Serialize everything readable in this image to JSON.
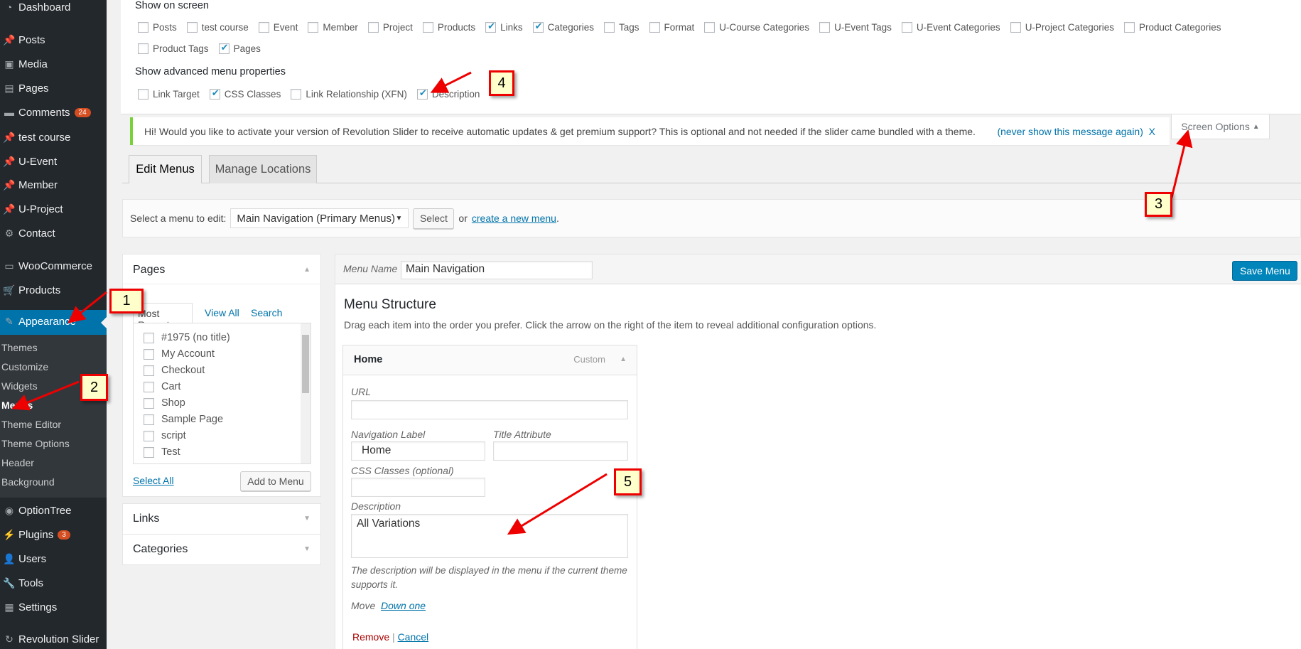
{
  "sidebar": {
    "items": [
      {
        "label": "Dashboard",
        "icon": "dashboard-icon"
      },
      {
        "label": "Posts",
        "icon": "pin-icon"
      },
      {
        "label": "Media",
        "icon": "media-icon"
      },
      {
        "label": "Pages",
        "icon": "pages-icon"
      },
      {
        "label": "Comments",
        "icon": "comment-icon",
        "badge": "24"
      },
      {
        "label": "test course",
        "icon": "pin-icon"
      },
      {
        "label": "U-Event",
        "icon": "pin-icon"
      },
      {
        "label": "Member",
        "icon": "pin-icon"
      },
      {
        "label": "U-Project",
        "icon": "pin-icon"
      },
      {
        "label": "Contact",
        "icon": "gear-icon"
      },
      {
        "label": "WooCommerce",
        "icon": "woo-icon"
      },
      {
        "label": "Products",
        "icon": "cart-icon"
      },
      {
        "label": "Appearance",
        "icon": "brush-icon"
      },
      {
        "label": "OptionTree",
        "icon": "optiontree-icon"
      },
      {
        "label": "Plugins",
        "icon": "plugin-icon",
        "badge": "3"
      },
      {
        "label": "Users",
        "icon": "user-icon"
      },
      {
        "label": "Tools",
        "icon": "wrench-icon"
      },
      {
        "label": "Settings",
        "icon": "settings-icon"
      },
      {
        "label": "Revolution Slider",
        "icon": "refresh-icon"
      }
    ],
    "submenu": [
      "Themes",
      "Customize",
      "Widgets",
      "Menus",
      "Theme Editor",
      "Theme Options",
      "Header",
      "Background"
    ],
    "active_sub": "Menus"
  },
  "screen_options": {
    "show_on_screen": "Show on screen",
    "boxes": [
      {
        "label": "Posts",
        "checked": false
      },
      {
        "label": "test course",
        "checked": false
      },
      {
        "label": "Event",
        "checked": false
      },
      {
        "label": "Member",
        "checked": false
      },
      {
        "label": "Project",
        "checked": false
      },
      {
        "label": "Products",
        "checked": false
      },
      {
        "label": "Links",
        "checked": true
      },
      {
        "label": "Categories",
        "checked": true
      },
      {
        "label": "Tags",
        "checked": false
      },
      {
        "label": "Format",
        "checked": false
      },
      {
        "label": "U-Course Categories",
        "checked": false
      },
      {
        "label": "U-Event Tags",
        "checked": false
      },
      {
        "label": "U-Event Categories",
        "checked": false
      },
      {
        "label": "U-Project Categories",
        "checked": false
      },
      {
        "label": "Product Categories",
        "checked": false
      },
      {
        "label": "Product Tags",
        "checked": false
      },
      {
        "label": "Pages",
        "checked": true
      }
    ],
    "advanced_title": "Show advanced menu properties",
    "advanced": [
      {
        "label": "Link Target",
        "checked": false
      },
      {
        "label": "CSS Classes",
        "checked": true
      },
      {
        "label": "Link Relationship (XFN)",
        "checked": false
      },
      {
        "label": "Description",
        "checked": true
      }
    ],
    "tab_label": "Screen Options"
  },
  "notice": {
    "text": "Hi! Would you like to activate your version of Revolution Slider to receive automatic updates & get premium support? This is optional and not needed if the slider came bundled with a theme.",
    "link": "(never show this message again)",
    "close": "X"
  },
  "tabs": [
    "Edit Menus",
    "Manage Locations"
  ],
  "menu_select": {
    "label": "Select a menu to edit:",
    "value": "Main Navigation (Primary Menus)",
    "button": "Select",
    "or": "or",
    "create_link": "create a new menu",
    "period": "."
  },
  "pages_box": {
    "title": "Pages",
    "tabs": [
      "Most Recent",
      "View All",
      "Search"
    ],
    "items": [
      "#1975 (no title)",
      "My Account",
      "Checkout",
      "Cart",
      "Shop",
      "Sample Page",
      "script",
      "Test"
    ],
    "select_all": "Select All",
    "add": "Add to Menu"
  },
  "other_boxes": [
    "Links",
    "Categories"
  ],
  "menu": {
    "name_label": "Menu Name",
    "name_value": "Main Navigation",
    "save": "Save Menu",
    "structure_title": "Menu Structure",
    "structure_help": "Drag each item into the order you prefer. Click the arrow on the right of the item to reveal additional configuration options.",
    "item": {
      "title": "Home",
      "type": "Custom",
      "url_label": "URL",
      "url_value": "",
      "nav_label": "Navigation Label",
      "nav_value": "Home",
      "title_attr_label": "Title Attribute",
      "title_attr_value": "",
      "css_label": "CSS Classes (optional)",
      "css_value": "",
      "desc_label": "Description",
      "desc_value": "All Variations",
      "desc_help": "The description will be displayed in the menu if the current theme supports it.",
      "move": "Move",
      "down_one": "Down one",
      "remove": "Remove",
      "sep": "|",
      "cancel": "Cancel"
    }
  },
  "annotations": [
    "1",
    "2",
    "3",
    "4",
    "5"
  ],
  "colors": {
    "sidebar": "#23282d",
    "active": "#0073aa",
    "primary": "#0085ba",
    "notice": "#7ad03a",
    "annotation": "#e00000"
  }
}
